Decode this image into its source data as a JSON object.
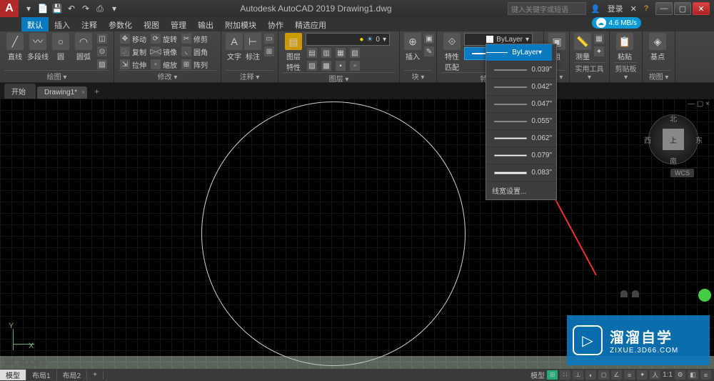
{
  "title": "Autodesk AutoCAD 2019    Drawing1.dwg",
  "search_placeholder": "键入关键字或短语",
  "login": "登录",
  "speed": "4.6 MB/s",
  "menu": [
    "默认",
    "插入",
    "注释",
    "参数化",
    "视图",
    "管理",
    "输出",
    "附加模块",
    "协作",
    "精选应用"
  ],
  "ribbon": {
    "draw": {
      "label": "绘图 ▾",
      "line": "直线",
      "poly": "多段线",
      "circ": "圆",
      "arc": "圆弧"
    },
    "modify": {
      "label": "修改 ▾",
      "move": "移动",
      "rotate": "旋转",
      "trim": "修剪",
      "copy": "复制",
      "mirror": "镜像",
      "fillet": "圆角",
      "stretch": "拉伸",
      "scale": "缩放",
      "array": "阵列"
    },
    "annot": {
      "label": "注释 ▾",
      "text": "文字",
      "dim": "标注"
    },
    "layer": {
      "label": "图层 ▾",
      "prop": "图层\n特性"
    },
    "block": {
      "label": "块 ▾",
      "ins": "插入"
    },
    "props": {
      "label": "特性 ▾",
      "btn": "特性\n匹配",
      "l1": "ByLayer",
      "l2": "ByLayer"
    },
    "group": {
      "label": "组 ▾",
      "btn": "组"
    },
    "util": {
      "label": "实用工具 ▾",
      "meas": "测量"
    },
    "clip": {
      "label": "剪贴板 ▾",
      "paste": "粘贴"
    },
    "view": {
      "label": "视图 ▾",
      "base": "基点"
    }
  },
  "tabs": {
    "start": "开始",
    "doc": "Drawing1*"
  },
  "cmd_hint": "键入命令",
  "lineweights": {
    "bylayer": "ByLayer",
    "items": [
      "0.039\"",
      "0.042\"",
      "0.047\"",
      "0.055\"",
      "0.062\"",
      "0.079\"",
      "0.083\""
    ],
    "settings": "线宽设置..."
  },
  "viewcube": {
    "top": "上",
    "n": "北",
    "s": "南",
    "e": "东",
    "w": "西",
    "wcs": "WCS"
  },
  "layout": {
    "model": "模型",
    "l1": "布局1",
    "l2": "布局2"
  },
  "status": {
    "model": "模型",
    "scale": "1:1"
  },
  "wm": {
    "name": "溜溜自学",
    "url": "ZIXUE.3D66.COM"
  }
}
